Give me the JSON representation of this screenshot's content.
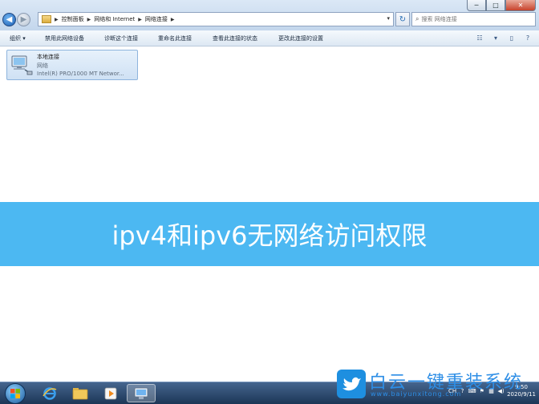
{
  "window": {
    "controls": {
      "minimize": "─",
      "maximize": "□",
      "close": "✕"
    }
  },
  "address": {
    "crumbs": [
      "控制面板",
      "网络和 Internet",
      "网络连接"
    ]
  },
  "search": {
    "placeholder": "搜索 网络连接"
  },
  "toolbar": {
    "organize": "组织 ▾",
    "disable": "禁用此网络设备",
    "diagnose": "诊断这个连接",
    "rename": "重命名此连接",
    "status": "查看此连接的状态",
    "settings": "更改此连接的设置"
  },
  "connection": {
    "name": "本地连接",
    "network": "网络",
    "adapter": "Intel(R) PRO/1000 MT Networ..."
  },
  "banner": {
    "text": "ipv4和ipv6无网络访问权限"
  },
  "watermark": {
    "title": "白云一键重装系统",
    "url": "www.baiyunxitong.com"
  },
  "taskbar": {
    "lang": "CH",
    "time": "9:50",
    "date": "2020/9/11"
  },
  "colors": {
    "banner": "#4cb8f2",
    "accent": "#2d8ee6"
  }
}
